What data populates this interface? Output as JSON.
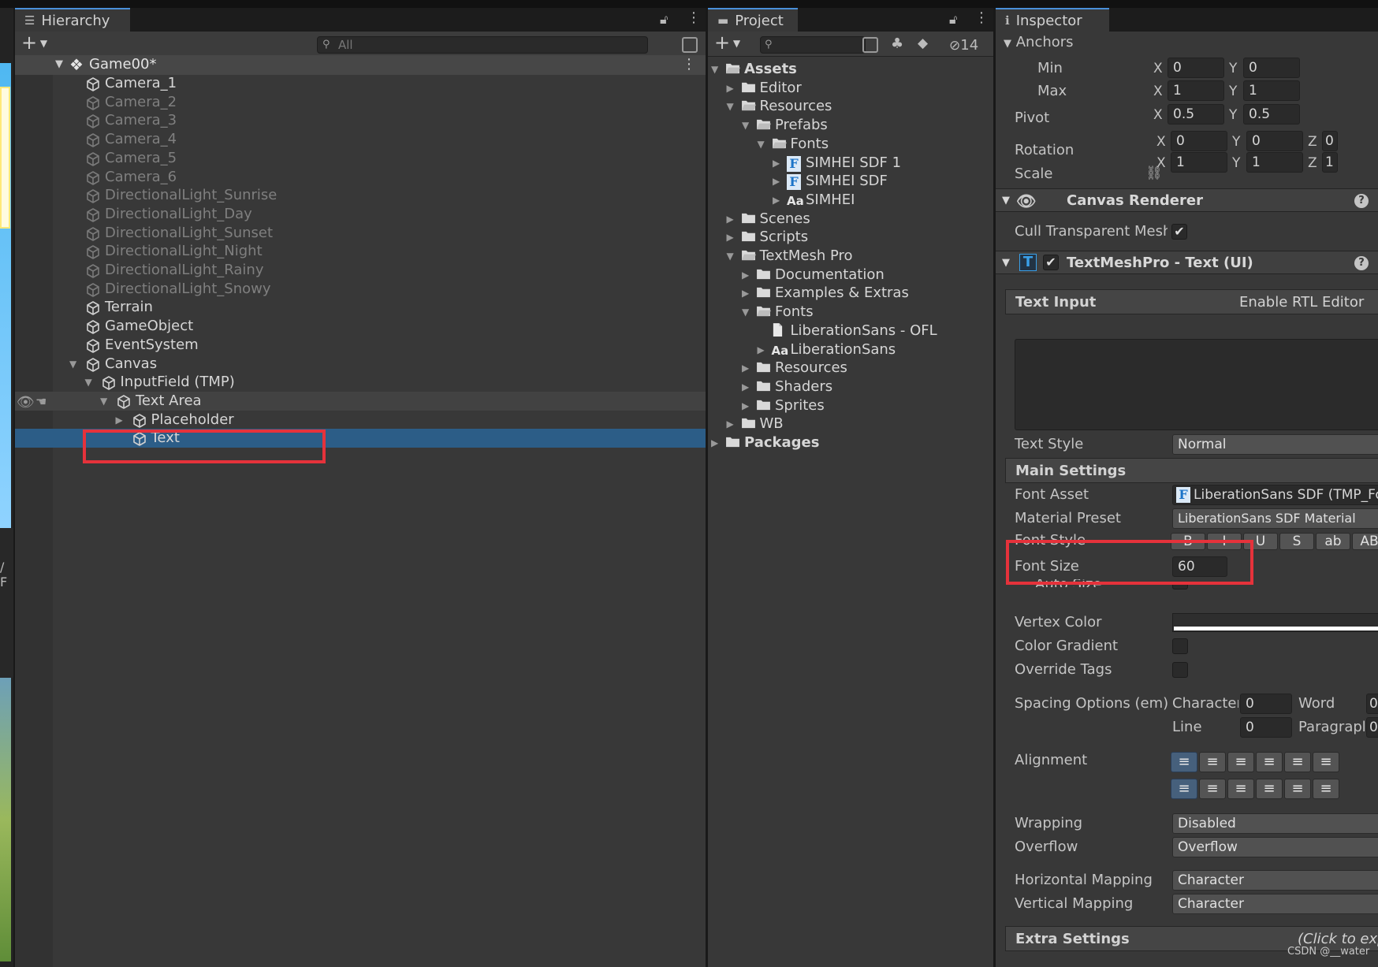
{
  "hierarchy": {
    "tab_label": "Hierarchy",
    "search_placeholder": "All",
    "scene_name": "Game00*",
    "items": [
      {
        "label": "Camera_1",
        "active": true
      },
      {
        "label": "Camera_2",
        "active": false
      },
      {
        "label": "Camera_3",
        "active": false
      },
      {
        "label": "Camera_4",
        "active": false
      },
      {
        "label": "Camera_5",
        "active": false
      },
      {
        "label": "Camera_6",
        "active": false
      },
      {
        "label": "DirectionalLight_Sunrise",
        "active": false
      },
      {
        "label": "DirectionalLight_Day",
        "active": false
      },
      {
        "label": "DirectionalLight_Sunset",
        "active": false
      },
      {
        "label": "DirectionalLight_Night",
        "active": false
      },
      {
        "label": "DirectionalLight_Rainy",
        "active": false
      },
      {
        "label": "DirectionalLight_Snowy",
        "active": false
      },
      {
        "label": "Terrain",
        "active": true
      },
      {
        "label": "GameObject",
        "active": true
      },
      {
        "label": "EventSystem",
        "active": true
      },
      {
        "label": "Canvas",
        "active": true
      },
      {
        "label": "InputField (TMP)",
        "active": true
      },
      {
        "label": "Text Area",
        "active": true
      },
      {
        "label": "Placeholder",
        "active": true
      },
      {
        "label": "Text",
        "active": true
      }
    ]
  },
  "left_edge_label": "/ F",
  "project": {
    "tab_label": "Project",
    "hidden_count": "14",
    "items": [
      {
        "label": "Assets",
        "bold": true
      },
      {
        "label": "Editor"
      },
      {
        "label": "Resources"
      },
      {
        "label": "Prefabs"
      },
      {
        "label": "Fonts"
      },
      {
        "label": "SIMHEI SDF 1",
        "icon_text": "F"
      },
      {
        "label": "SIMHEI SDF",
        "icon_text": "F"
      },
      {
        "label": "SIMHEI",
        "icon_text": "Aa"
      },
      {
        "label": "Scenes"
      },
      {
        "label": "Scripts"
      },
      {
        "label": "TextMesh Pro"
      },
      {
        "label": "Documentation"
      },
      {
        "label": "Examples & Extras"
      },
      {
        "label": "Fonts"
      },
      {
        "label": "LiberationSans - OFL"
      },
      {
        "label": "LiberationSans",
        "icon_text": "Aa"
      },
      {
        "label": "Resources"
      },
      {
        "label": "Shaders"
      },
      {
        "label": "Sprites"
      },
      {
        "label": "WB"
      },
      {
        "label": "Packages",
        "bold": true
      }
    ]
  },
  "inspector": {
    "tab_label": "Inspector",
    "anchors_label": "Anchors",
    "min_label": "Min",
    "max_label": "Max",
    "pivot_label": "Pivot",
    "rotation_label": "Rotation",
    "scale_label": "Scale",
    "axis_x": "X",
    "axis_y": "Y",
    "axis_z": "Z",
    "min_x": "0",
    "min_y": "0",
    "max_x": "1",
    "max_y": "1",
    "pivot_x": "0.5",
    "pivot_y": "0.5",
    "rot_x": "0",
    "rot_y": "0",
    "rot_z": "0",
    "scale_x": "1",
    "scale_y": "1",
    "scale_z": "1",
    "canvas_renderer": "Canvas Renderer",
    "cull_label": "Cull Transparent Mesh",
    "tmp_component": "TextMeshPro - Text (UI)",
    "tmp_icon": "T",
    "text_input_label": "Text Input",
    "rtl_label": "Enable RTL Editor",
    "text_style_label": "Text Style",
    "text_style_value": "Normal",
    "main_settings_label": "Main Settings",
    "font_asset_label": "Font Asset",
    "font_asset_icon": "F",
    "font_asset_value": "LiberationSans SDF (TMP_Font Asset)",
    "material_preset_label": "Material Preset",
    "material_preset_value": "LiberationSans SDF Material",
    "font_style_label": "Font Style",
    "font_style_buttons": [
      "B",
      "I",
      "U",
      "S",
      "ab",
      "AB"
    ],
    "font_size_label": "Font Size",
    "font_size_value": "60",
    "auto_size_label": "Auto Size",
    "vertex_color_label": "Vertex Color",
    "color_gradient_label": "Color Gradient",
    "override_tags_label": "Override Tags",
    "spacing_label": "Spacing Options (em)",
    "character_label": "Character",
    "character_value": "0",
    "word_label": "Word",
    "word_value": "0",
    "line_label": "Line",
    "line_value": "0",
    "paragraph_label": "Paragraph",
    "paragraph_value": "0",
    "alignment_label": "Alignment",
    "wrapping_label": "Wrapping",
    "wrapping_value": "Disabled",
    "overflow_label": "Overflow",
    "overflow_value": "Overflow",
    "hmapping_label": "Horizontal Mapping",
    "hmapping_value": "Character",
    "vmapping_label": "Vertical Mapping",
    "vmapping_value": "Character",
    "extra_settings_label": "Extra Settings",
    "extra_settings_hint": "(Click to expand)",
    "help_glyph": "?"
  },
  "watermark": "CSDN @__water",
  "colors": {
    "selection": "#2c5d87",
    "highlight": "#e5323b",
    "accent": "#4a90d9"
  }
}
